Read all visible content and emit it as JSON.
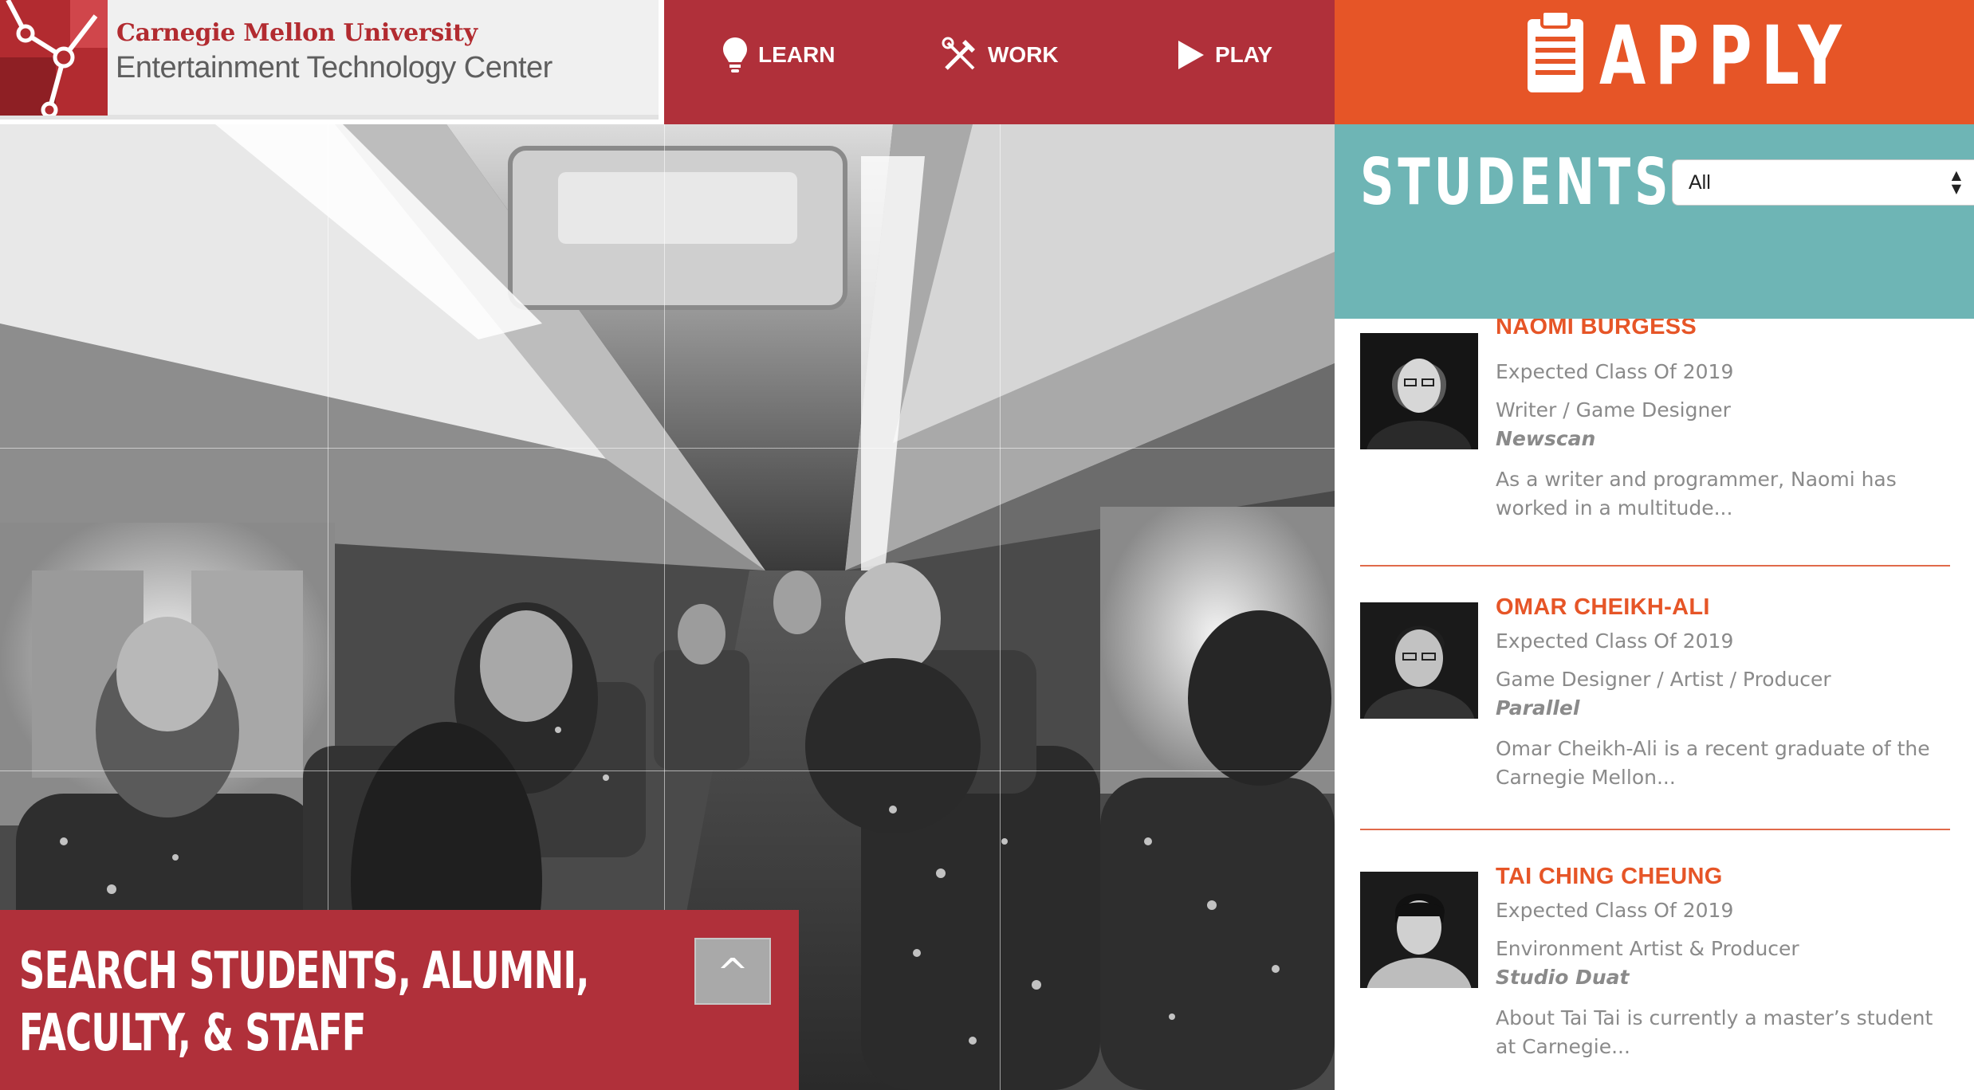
{
  "logo": {
    "university": "Carnegie Mellon University",
    "center": "Entertainment Technology Center"
  },
  "nav": {
    "items": [
      {
        "label": "LEARN",
        "icon": "lightbulb-icon"
      },
      {
        "label": "WORK",
        "icon": "tools-icon"
      },
      {
        "label": "PLAY",
        "icon": "play-icon"
      }
    ]
  },
  "apply": {
    "label": "APPLY",
    "icon": "clipboard-icon"
  },
  "hero": {
    "search_title_line1": "SEARCH STUDENTS, ALUMNI,",
    "search_title_line2": "FACULTY, & STAFF",
    "toggle_label": "^"
  },
  "students": {
    "title": "STUDENTS",
    "filter_value": "All"
  },
  "people": [
    {
      "name": "NAOMI BURGESS",
      "class_year": "Expected Class Of 2019",
      "role": "Writer / Game Designer",
      "project": "Newscan",
      "excerpt_line1": "As a writer and programmer, Naomi has",
      "excerpt_line2": "worked in a multitude..."
    },
    {
      "name": "OMAR CHEIKH-ALI",
      "class_year": "Expected Class Of 2019",
      "role": "Game Designer / Artist / Producer",
      "project": "Parallel",
      "excerpt_line1": "Omar Cheikh-Ali is a recent graduate of the",
      "excerpt_line2": "Carnegie Mellon..."
    },
    {
      "name": "TAI CHING CHEUNG",
      "class_year": "Expected Class Of 2019",
      "role": "Environment Artist & Producer",
      "project": "Studio Duat",
      "excerpt_line1": "About Tai Tai is currently a master’s student",
      "excerpt_line2": "at Carnegie..."
    }
  ],
  "colors": {
    "brand_red": "#b0303a",
    "apply_orange": "#e65527",
    "teal": "#6eb5b5",
    "name_orange": "#e65527"
  }
}
